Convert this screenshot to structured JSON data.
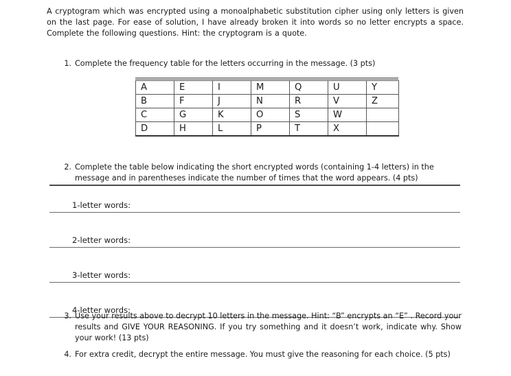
{
  "document": {
    "intro": "A cryptogram which was encrypted using a monoalphabetic substitution cipher using only letters is given on the last page.  For ease of solution, I have already broken it into words so no letter encrypts a space.  Complete the following questions. Hint: the cryptogram is a quote."
  },
  "questions": [
    {
      "number": "1.",
      "text": "Complete the frequency table for the letters occurring in the message.  (3 pts)",
      "points": "3 pts"
    },
    {
      "number": "2.",
      "text": "Complete the table below indicating the short encrypted words (containing 1-4 letters) in the message and in parentheses indicate the number of times that the word appears.  (4 pts)",
      "points": "4 pts"
    },
    {
      "number": "3.",
      "text": "Use your results above to decrypt 10 letters in the message.  Hint:  “B” encrypts an “E” . Record your results and GIVE YOUR REASONING. If you try something and it doesn’t work, indicate why.  Show your work!  (13 pts)",
      "points": "13 pts"
    },
    {
      "number": "4.",
      "text": "For extra credit, decrypt the entire message.  You must give the reasoning for each choice.  (5 pts)",
      "points": "5 pts"
    }
  ],
  "frequency_table": {
    "rows": [
      [
        "A",
        "E",
        "I",
        "M",
        "Q",
        "U",
        "Y"
      ],
      [
        "B",
        "F",
        "J",
        "N",
        "R",
        "V",
        "Z"
      ],
      [
        "C",
        "G",
        "K",
        "O",
        "S",
        "W",
        ""
      ],
      [
        "D",
        "H",
        "L",
        "P",
        "T",
        "X",
        ""
      ]
    ]
  },
  "word_rows": [
    {
      "label": "1-letter words:"
    },
    {
      "label": "2-letter words:"
    },
    {
      "label": "3-letter words:"
    },
    {
      "label": "4-letter words:"
    }
  ]
}
